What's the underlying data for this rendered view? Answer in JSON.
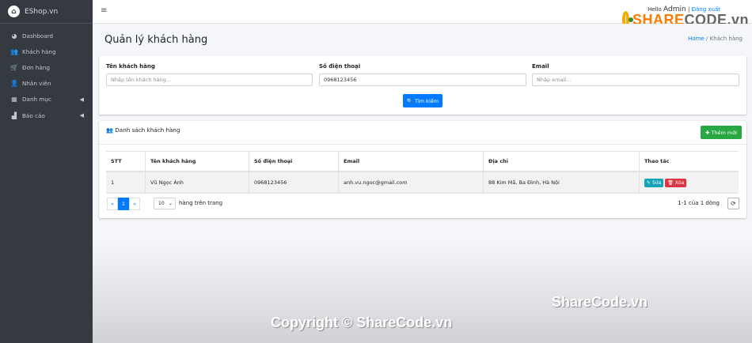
{
  "brand": {
    "name": "EShop.vn"
  },
  "sidebar": {
    "items": [
      {
        "label": "Dashboard",
        "icon": "dashboard-icon"
      },
      {
        "label": "Khách hàng",
        "icon": "users-icon"
      },
      {
        "label": "Đơn hàng",
        "icon": "cart-icon"
      },
      {
        "label": "Nhân viên",
        "icon": "user-icon"
      },
      {
        "label": "Danh mục",
        "icon": "table-icon",
        "chevron": true
      },
      {
        "label": "Báo cáo",
        "icon": "chart-icon",
        "chevron": true
      }
    ]
  },
  "topbar": {
    "greeting": "Hello",
    "username": "Admin",
    "separator": "|",
    "logout": "Đăng xuất"
  },
  "watermark": {
    "logo_main": "SHARE",
    "logo_sub": "CODE.vn",
    "text1": "ShareCode.vn",
    "text2": "Copyright © ShareCode.vn"
  },
  "page": {
    "title": "Quản lý khách hàng",
    "breadcrumb_home": "Home",
    "breadcrumb_sep": "/",
    "breadcrumb_current": "Khách hàng"
  },
  "search": {
    "name_label": "Tên khách hàng",
    "name_placeholder": "Nhập tên khách hàng...",
    "phone_label": "Số điện thoại",
    "phone_value": "0968123456",
    "email_label": "Email",
    "email_placeholder": "Nhập email...",
    "button": "Tìm kiếm"
  },
  "list": {
    "title": "Danh sách khách hàng",
    "add_button": "Thêm mới",
    "columns": [
      "STT",
      "Tên khách hàng",
      "Số điện thoại",
      "Email",
      "Địa chỉ",
      "Thao tác"
    ],
    "rows": [
      {
        "stt": "1",
        "name": "Vũ Ngọc Ánh",
        "phone": "0968123456",
        "email": "anh.vu.ngoc@gmail.com",
        "address": "88 Kim Mã, Ba Đình, Hà Nội",
        "edit": "Sửa",
        "delete": "Xóa"
      }
    ],
    "pager": {
      "prev": "«",
      "current": "1",
      "next": "»"
    },
    "page_size": "10",
    "page_size_label": "hàng trên trang",
    "count": "1-1 của 1 dòng"
  }
}
